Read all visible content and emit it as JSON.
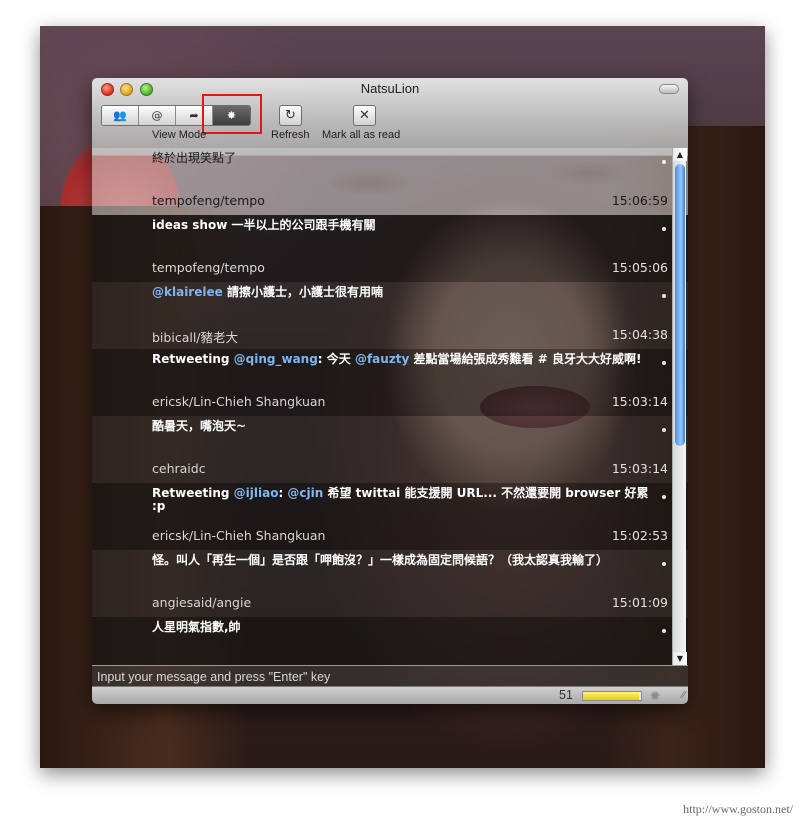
{
  "window": {
    "title": "NatsuLion"
  },
  "toolbar": {
    "view_mode_label": "View Mode",
    "refresh_label": "Refresh",
    "mark_all_label": "Mark all as read",
    "view_mode_segments": [
      {
        "icon": "friends-icon",
        "glyph": "👥"
      },
      {
        "icon": "mentions-icon",
        "glyph": "@"
      },
      {
        "icon": "sent-icon",
        "glyph": "➦"
      },
      {
        "icon": "star-icon",
        "glyph": "✸"
      }
    ],
    "refresh_glyph": "↻",
    "mark_glyph": "✕"
  },
  "timeline": [
    {
      "message": "終於出現笑點了",
      "user": "tempofeng/tempo",
      "time": "15:06:59"
    },
    {
      "message": "ideas show 一半以上的公司跟手機有關",
      "user": "tempofeng/tempo",
      "time": "15:05:06"
    },
    {
      "message_parts": [
        {
          "text": "@klairelee",
          "mention": true
        },
        {
          "text": " 請擦小護士，小護士很有用喃",
          "mention": false
        }
      ],
      "user": "bibicall/豬老大",
      "time": "15:04:38"
    },
    {
      "message_parts": [
        {
          "text": "Retweeting ",
          "mention": false
        },
        {
          "text": "@qing_wang",
          "mention": true
        },
        {
          "text": ": 今天 ",
          "mention": false
        },
        {
          "text": "@fauzty",
          "mention": true
        },
        {
          "text": " 差點當場給張成秀難看 # 良牙大大好威啊!",
          "mention": false
        }
      ],
      "user": "ericsk/Lin-Chieh Shangkuan",
      "time": "15:03:14"
    },
    {
      "message": "酷暑天，嘴泡天~",
      "user": "cehraidc",
      "time": "15:03:14"
    },
    {
      "message_parts": [
        {
          "text": "Retweeting ",
          "mention": false
        },
        {
          "text": "@ijliao",
          "mention": true
        },
        {
          "text": ": ",
          "mention": false
        },
        {
          "text": "@cjin",
          "mention": true
        },
        {
          "text": " 希望 twittai 能支援開 URL... 不然還要開 browser 好累 :p",
          "mention": false
        }
      ],
      "user": "ericsk/Lin-Chieh Shangkuan",
      "time": "15:02:53"
    },
    {
      "message": "怪。叫人「再生一個」是否跟「呷飽沒？」一樣成為固定問候語？（我太認真我輸了）",
      "user": "angiesaid/angie",
      "time": "15:01:09"
    },
    {
      "message": "人星明氣指數,帥",
      "user": "",
      "time": ""
    }
  ],
  "input": {
    "placeholder": "Input your message and press \"Enter\" key"
  },
  "status": {
    "remaining_count": "51",
    "progress_fraction": 0.97
  },
  "watermark": "http://www.goston.net/"
}
